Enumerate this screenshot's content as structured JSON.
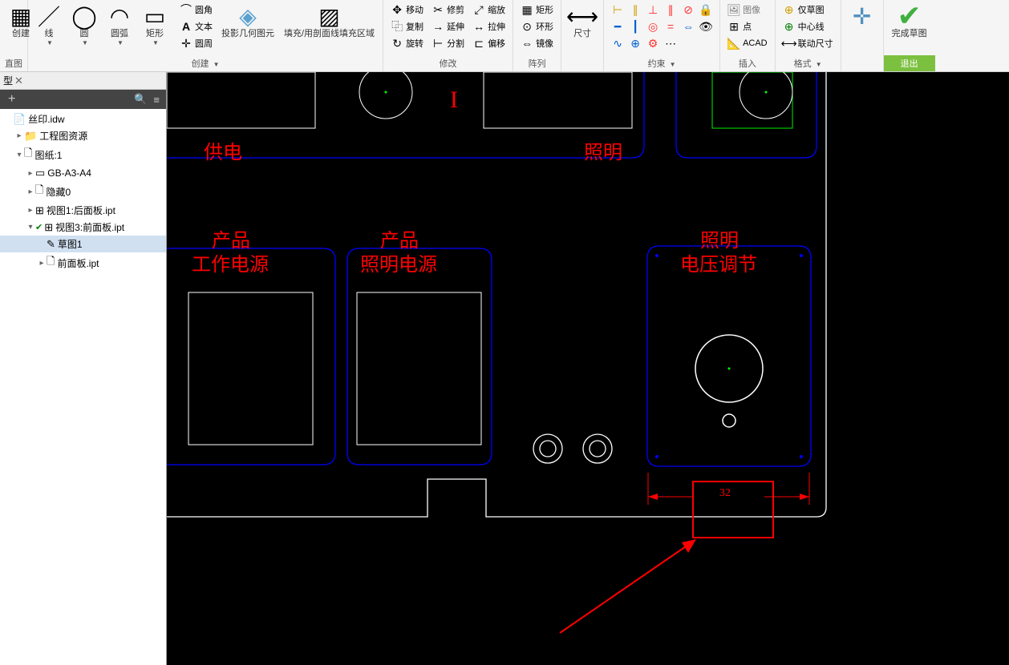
{
  "ribbon": {
    "groups": {
      "create_left": {
        "label": "",
        "b1": "创建",
        "b2": "直图"
      },
      "create": {
        "label": "创建",
        "line": "线",
        "circle": "圆",
        "arc": "圆弧",
        "rect": "矩形",
        "text": "文本",
        "geom": "圆角",
        "fillet": "圆周"
      },
      "project": {
        "b1": "投影几何图元",
        "b2": "填充/用剖面线填充区域"
      },
      "modify": {
        "label": "修改",
        "move": "移动",
        "copy": "复制",
        "rotate": "旋转",
        "trim": "修剪",
        "extend": "延伸",
        "split": "分割",
        "scale": "缩放",
        "stretch": "拉伸",
        "offset": "偏移"
      },
      "pattern": {
        "label": "阵列",
        "rect_pat": "矩形",
        "circ_pat": "环形",
        "mirror": "镜像"
      },
      "dim": {
        "label": "",
        "dim": "尺寸"
      },
      "constrain": {
        "label": "约束"
      },
      "insert": {
        "label": "插入",
        "image": "图像",
        "point": "点",
        "acad": "ACAD"
      },
      "format": {
        "label": "格式",
        "ref": "仅草图",
        "center": "中心线",
        "driven": "联动尺寸"
      },
      "finish": {
        "label": "退出",
        "finish": "完成草图"
      }
    }
  },
  "browser": {
    "title": "型",
    "items": [
      {
        "indent": 0,
        "icon": "📄",
        "label": "丝印.idw",
        "exp": ""
      },
      {
        "indent": 1,
        "icon": "📁",
        "label": "工程图资源",
        "exp": "▸"
      },
      {
        "indent": 1,
        "icon": "🗋",
        "label": "图纸:1",
        "exp": "▾"
      },
      {
        "indent": 2,
        "icon": "▭",
        "label": "GB-A3-A4",
        "exp": "▸"
      },
      {
        "indent": 2,
        "icon": "🗋",
        "label": "隐藏0",
        "exp": "▸"
      },
      {
        "indent": 2,
        "icon": "⊞",
        "label": "视图1:后面板.ipt",
        "exp": "▸"
      },
      {
        "indent": 2,
        "icon": "⊞",
        "label": "视图3:前面板.ipt",
        "exp": "▾",
        "check": true
      },
      {
        "indent": 3,
        "icon": "✎",
        "label": "草图1",
        "exp": "",
        "selected": true
      },
      {
        "indent": 3,
        "icon": "🗋",
        "label": "前面板.ipt",
        "exp": "▸"
      }
    ]
  },
  "canvas": {
    "exit_label": "退出",
    "labels": {
      "power": "供电",
      "light": "照明",
      "prod1a": "产品",
      "prod1b": "工作电源",
      "prod2a": "产品",
      "prod2b": "照明电源",
      "adj1": "照明",
      "adj2": "电压调节"
    },
    "dim_value": "32"
  }
}
